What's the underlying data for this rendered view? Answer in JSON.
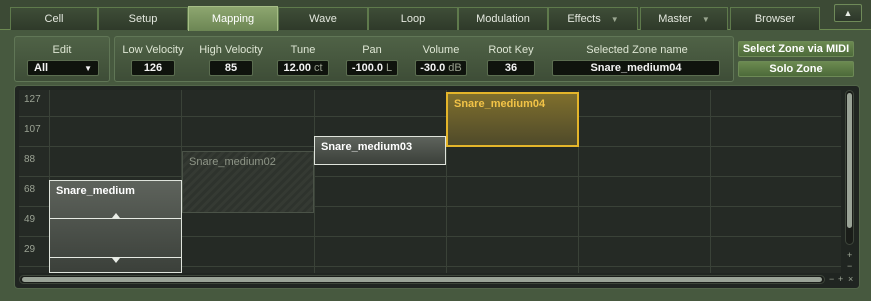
{
  "tabs": [
    {
      "label": "Cell",
      "active": false,
      "dropdown": false
    },
    {
      "label": "Setup",
      "active": false,
      "dropdown": false
    },
    {
      "label": "Mapping",
      "active": true,
      "dropdown": false
    },
    {
      "label": "Wave",
      "active": false,
      "dropdown": false
    },
    {
      "label": "Loop",
      "active": false,
      "dropdown": false
    },
    {
      "label": "Modulation",
      "active": false,
      "dropdown": false
    },
    {
      "label": "Effects",
      "active": false,
      "dropdown": true
    },
    {
      "label": "Master",
      "active": false,
      "dropdown": true
    },
    {
      "label": "Browser",
      "active": false,
      "dropdown": false
    }
  ],
  "collapse_icon": "▲",
  "params": {
    "edit": {
      "label": "Edit",
      "value": "All"
    },
    "low_velocity": {
      "label": "Low Velocity",
      "value": "126"
    },
    "high_velocity": {
      "label": "High Velocity",
      "value": "85"
    },
    "tune": {
      "label": "Tune",
      "value": "12.00",
      "unit": "ct"
    },
    "pan": {
      "label": "Pan",
      "value": "-100.0",
      "unit": "L"
    },
    "volume": {
      "label": "Volume",
      "value": "-30.0",
      "unit": "dB"
    },
    "root_key": {
      "label": "Root Key",
      "value": "36"
    },
    "zone_name": {
      "label": "Selected Zone name",
      "value": "Snare_medium04"
    },
    "select_zone_btn": "Select Zone via MIDI",
    "solo_zone_btn": "Solo Zone"
  },
  "map": {
    "row_labels": [
      "127",
      "107",
      "88",
      "68",
      "49",
      "29"
    ],
    "zones": [
      {
        "name": "Snare_medium04",
        "state": "selected"
      },
      {
        "name": "Snare_medium03",
        "state": "normal"
      },
      {
        "name": "Snare_medium02",
        "state": "dim"
      },
      {
        "name": "Snare_medium",
        "state": "normal"
      }
    ],
    "scroll_controls": {
      "plus": "+",
      "minus": "−",
      "close": "×"
    }
  },
  "colors": {
    "accent": "#7a9660",
    "selected_zone": "#e4b52a",
    "background": "#47593f"
  }
}
